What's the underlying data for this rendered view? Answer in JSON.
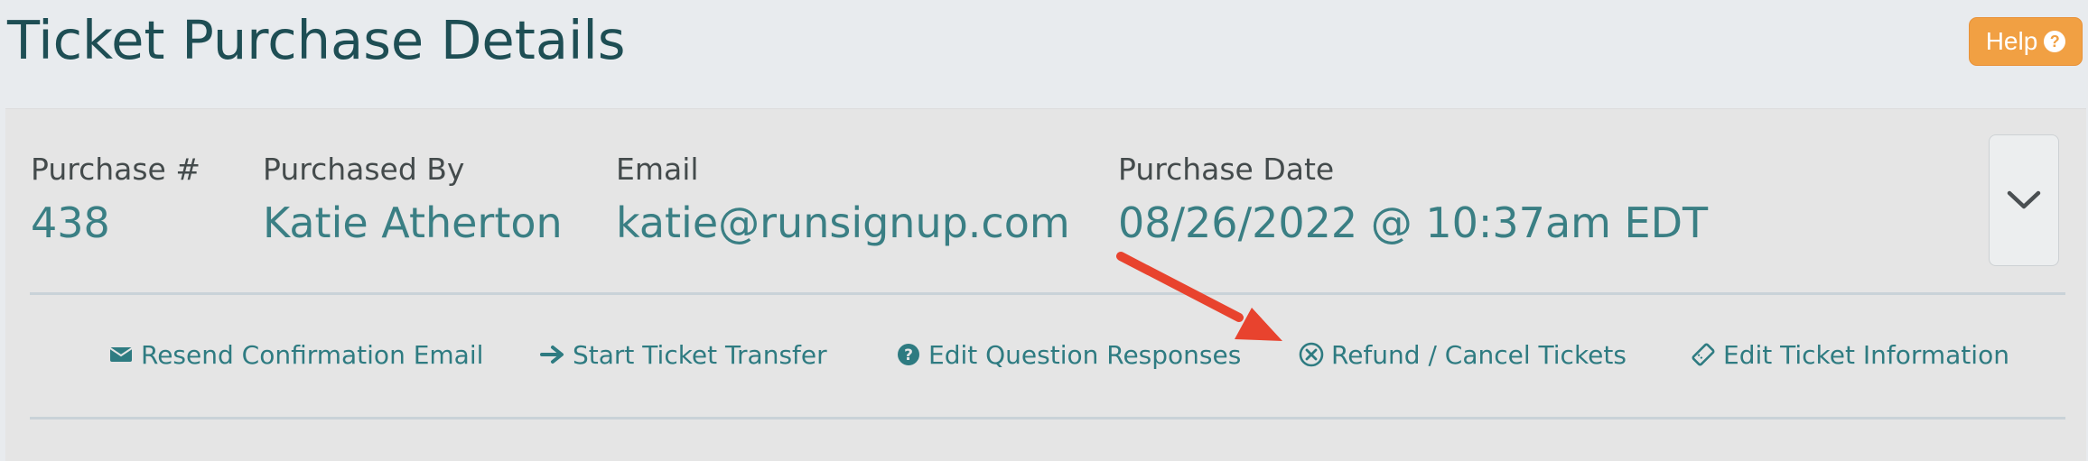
{
  "page": {
    "title": "Ticket Purchase Details",
    "help_label": "Help",
    "help_icon": "question-circle-icon"
  },
  "purchase": {
    "fields": [
      {
        "label": "Purchase #",
        "value": "438"
      },
      {
        "label": "Purchased By",
        "value": "Katie Atherton"
      },
      {
        "label": "Email",
        "value": "katie@runsignup.com"
      },
      {
        "label": "Purchase Date",
        "value": "08/26/2022 @ 10:37am EDT"
      }
    ],
    "toggle_icon": "chevron-down-icon"
  },
  "actions": [
    {
      "label": "Resend Confirmation Email",
      "icon": "envelope-icon"
    },
    {
      "label": "Start Ticket Transfer",
      "icon": "arrow-right-icon"
    },
    {
      "label": "Edit Question Responses",
      "icon": "question-circle-icon"
    },
    {
      "label": "Refund / Cancel Tickets",
      "icon": "times-circle-icon"
    },
    {
      "label": "Edit Ticket Information",
      "icon": "ticket-edit-icon"
    }
  ],
  "annotation": {
    "arrow_color": "#e8432e",
    "points_to": "Refund / Cancel Tickets"
  },
  "colors": {
    "background": "#e8ebee",
    "panel": "#e5e5e5",
    "title": "#1e4e54",
    "accent_teal": "#3a7f84",
    "link_teal": "#2e7b81",
    "help_orange": "#f1a043"
  }
}
